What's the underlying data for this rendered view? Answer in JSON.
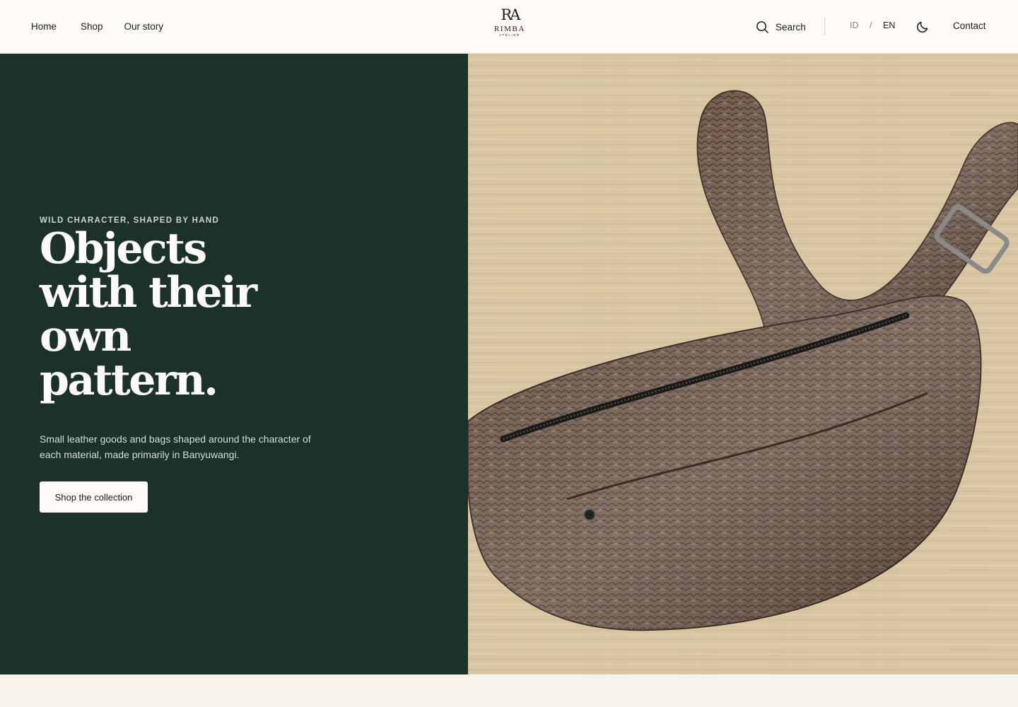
{
  "header": {
    "nav": [
      "Home",
      "Shop",
      "Our story"
    ],
    "logo": {
      "mark": "RA",
      "name": "RIMBA",
      "sub": "ATELIER"
    },
    "search_label": "Search",
    "lang": {
      "id": "ID",
      "sep": "/",
      "en": "EN",
      "active": "EN"
    },
    "theme_icon": "moon-icon",
    "contact_label": "Contact"
  },
  "hero": {
    "eyebrow": "WILD CHARACTER, SHAPED BY HAND",
    "headline_lines": [
      "Objects",
      "with their",
      "own",
      "pattern."
    ],
    "subcopy": "Small leather goods and bags shaped around the character of each material, made primarily in Banyuwangi.",
    "cta_label": "Shop the collection",
    "image_subject": "snakeskin-belt-bag-photo"
  },
  "colors": {
    "header_bg": "#fdfaf7",
    "hero_green": "#1b312a",
    "page_bg": "#f6f2ec",
    "wood": "#d9c7a4",
    "leather": "#5e4838"
  }
}
